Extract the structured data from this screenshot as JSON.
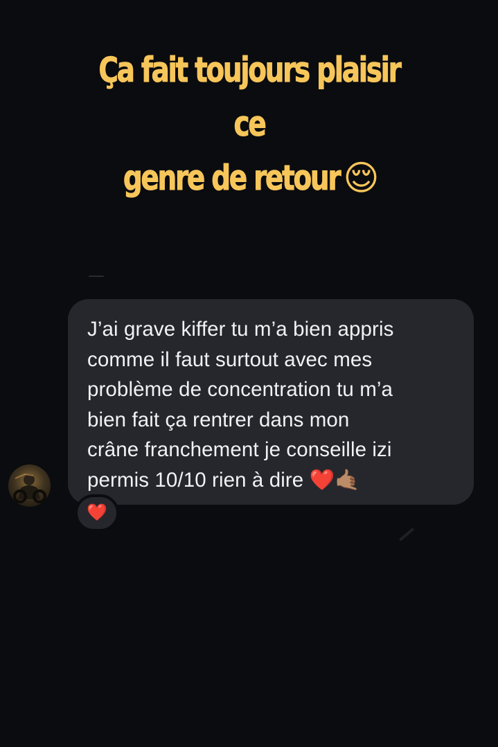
{
  "story": {
    "caption_line1": "Ça fait toujours plaisir ce",
    "caption_line2": "genre de retour",
    "caption_emoji": "😌"
  },
  "message": {
    "lines": [
      "J’ai grave kiffer tu m’a bien appris",
      "comme il faut surtout avec mes",
      "problème de concentration tu m’a",
      "bien fait ça rentrer dans mon",
      "crâne franchement je conseille izi",
      "permis 10/10 rien à dire ❤️🤙🏽"
    ],
    "reaction": "❤️"
  },
  "colors": {
    "background": "#0b0c10",
    "caption": "#f7c65a",
    "bubble": "#26272c",
    "text": "#f2f2f4"
  }
}
